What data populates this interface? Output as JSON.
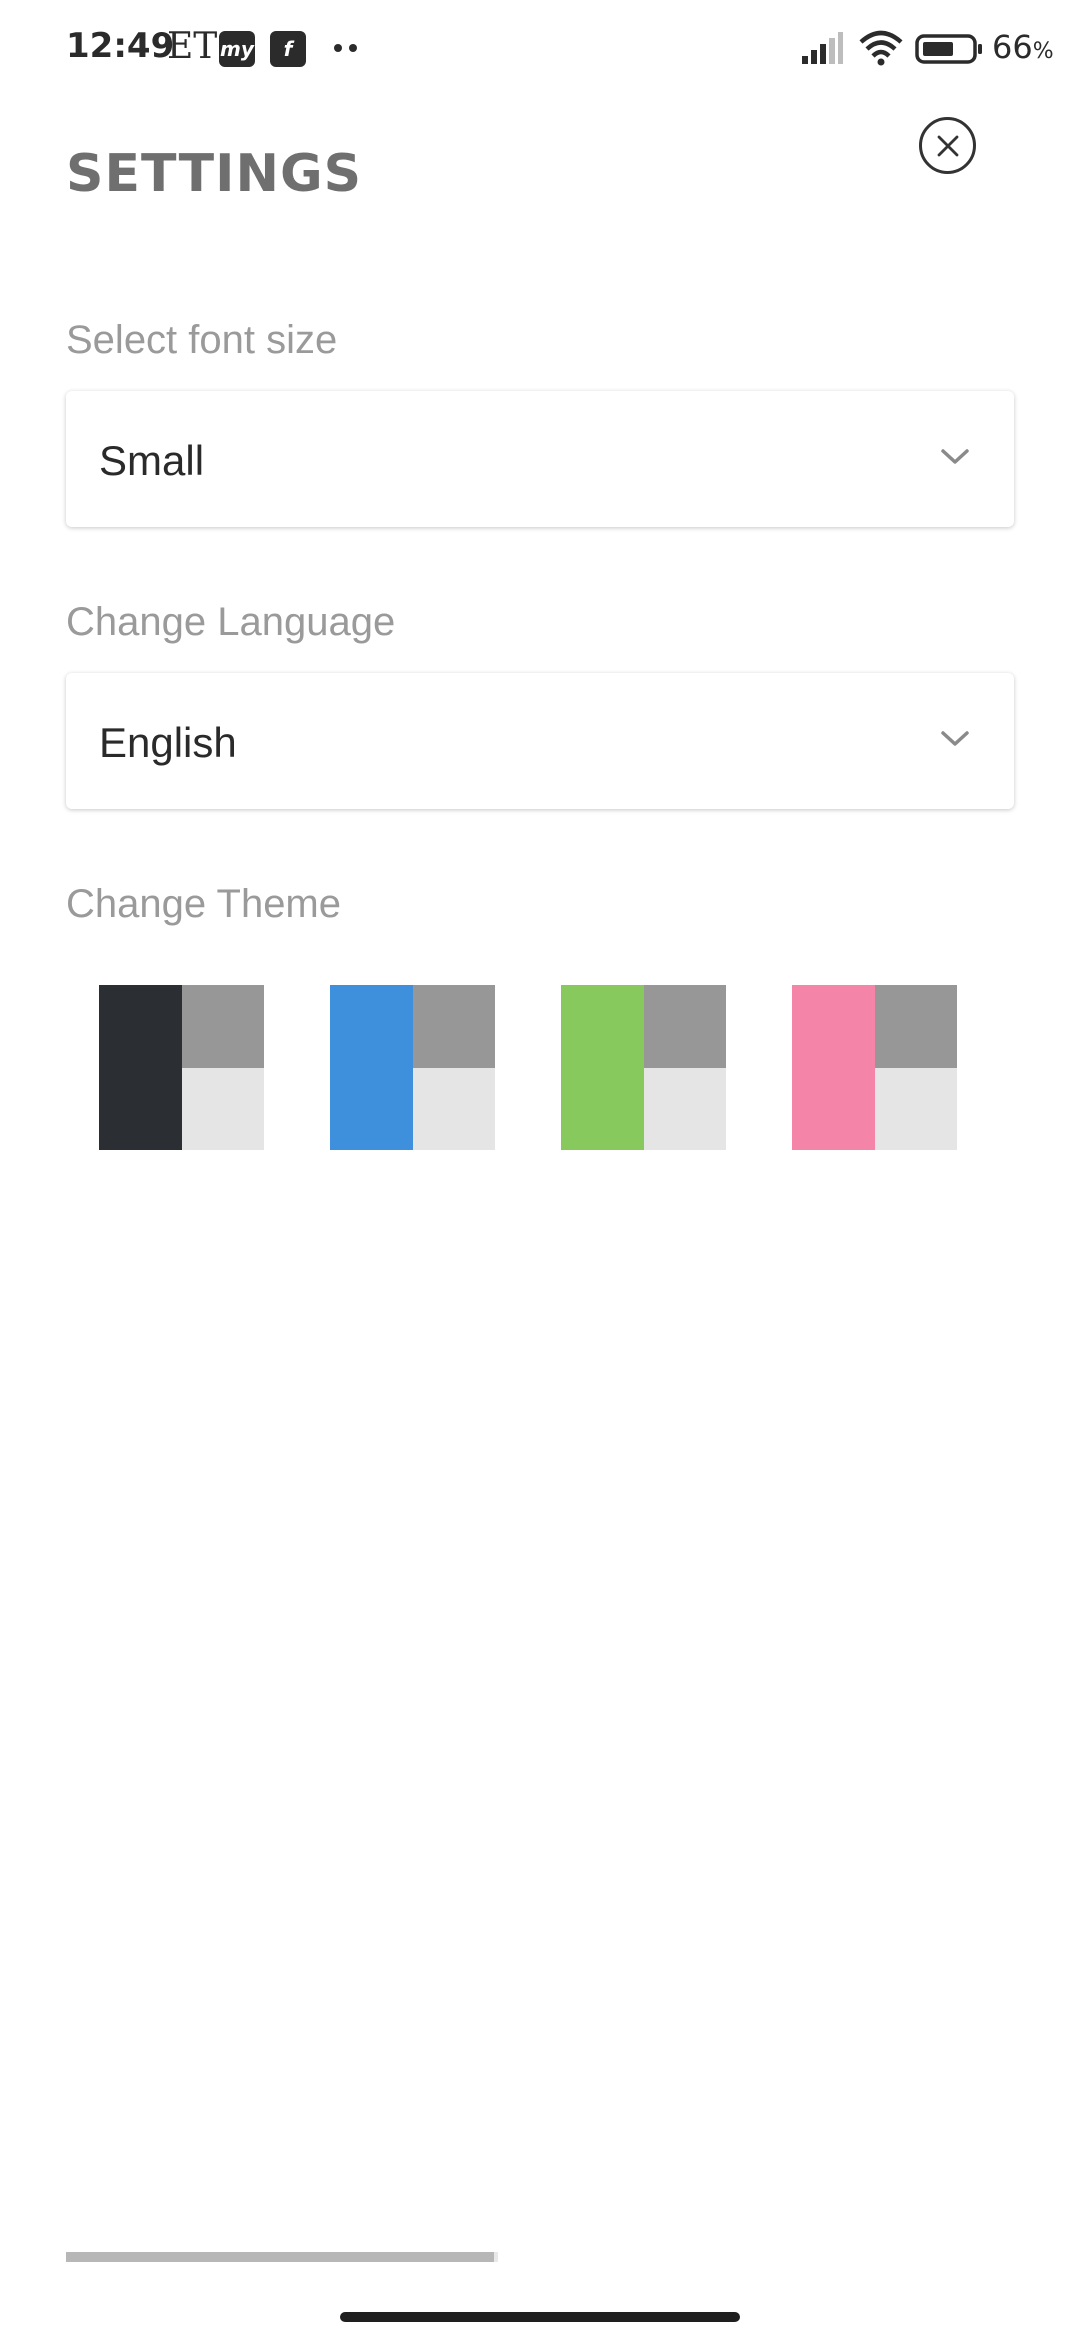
{
  "status_bar": {
    "time": "12:49",
    "et_label": "ET",
    "app_icon_1_text": "my",
    "app_icon_2_text": "f",
    "battery_percent": "66",
    "battery_suffix": "%",
    "battery_level": 0.66,
    "icons": [
      "signal-icon",
      "wifi-icon",
      "battery-icon"
    ]
  },
  "header": {
    "title": "SETTINGS",
    "close_icon": "close-icon"
  },
  "font_size": {
    "label": "Select font size",
    "selected": "Small"
  },
  "language": {
    "label": "Change Language",
    "selected": "English"
  },
  "theme": {
    "label": "Change Theme",
    "swatches": [
      {
        "name": "dark",
        "color": "#2b2e33"
      },
      {
        "name": "blue",
        "color": "#3e90dc"
      },
      {
        "name": "green",
        "color": "#88c95e"
      },
      {
        "name": "pink",
        "color": "#f484a8"
      }
    ],
    "secondary_color": "#979797",
    "tertiary_color": "#e5e5e5"
  },
  "bottom": {
    "scroll_progress": 0.99
  }
}
